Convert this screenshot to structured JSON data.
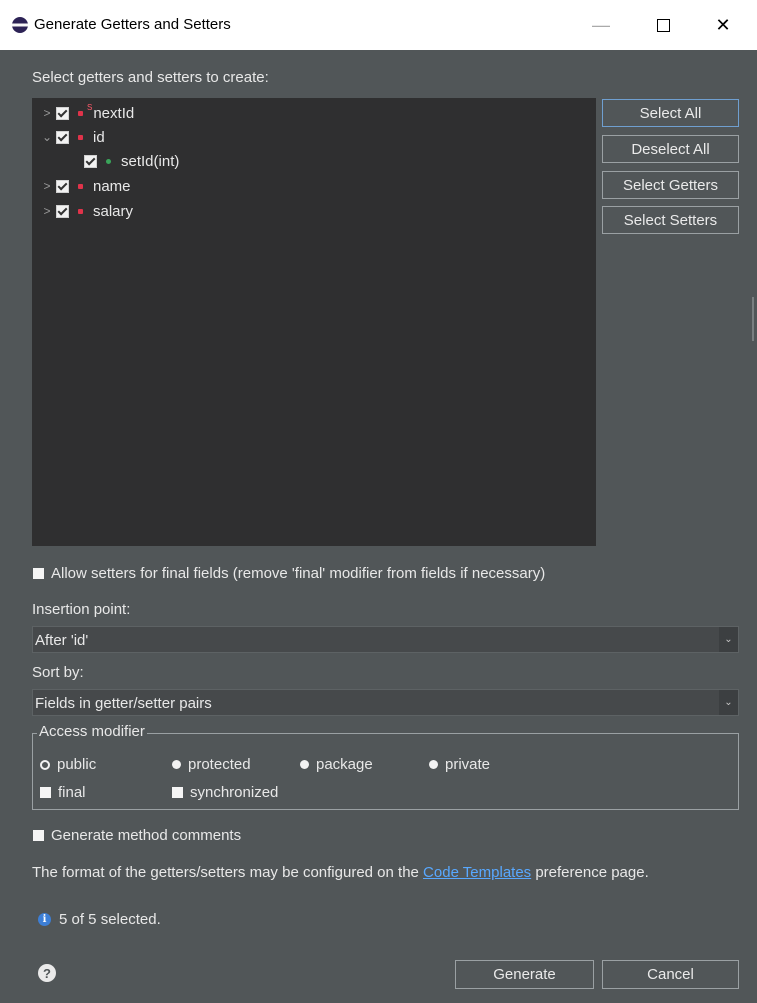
{
  "window": {
    "title": "Generate Getters and Setters",
    "minimize": "—",
    "close": "✕"
  },
  "dialog": {
    "tree_label": "Select getters and setters to create:",
    "tree": [
      {
        "label": "nextId",
        "expanded": false,
        "checked": true,
        "static_badge": "S",
        "level": 0
      },
      {
        "label": "id",
        "expanded": true,
        "checked": true,
        "level": 0
      },
      {
        "label": "setId(int)",
        "checked": true,
        "level": 1
      },
      {
        "label": "name",
        "expanded": false,
        "checked": true,
        "level": 0
      },
      {
        "label": "salary",
        "expanded": false,
        "checked": true,
        "level": 0
      }
    ],
    "buttons": {
      "select_all": "Select All",
      "deselect_all": "Deselect All",
      "select_getters": "Select Getters",
      "select_setters": "Select Setters"
    },
    "allow_final_label": "Allow setters for final fields (remove 'final' modifier from fields if necessary)",
    "insertion_point": {
      "label": "Insertion point:",
      "value": "After 'id'"
    },
    "sort_by": {
      "label": "Sort by:",
      "value": "Fields in getter/setter pairs"
    },
    "access_modifier": {
      "legend": "Access modifier",
      "options": [
        "public",
        "protected",
        "package",
        "private"
      ],
      "selected": "public",
      "final_label": "final",
      "synchronized_label": "synchronized"
    },
    "generate_comments_label": "Generate method comments",
    "format_note": {
      "before": "The format of the getters/setters may be configured on the ",
      "link": "Code Templates",
      "after": " preference page."
    },
    "status": "5 of 5 selected.",
    "footer": {
      "generate": "Generate",
      "cancel": "Cancel"
    }
  },
  "colors": {
    "background": "#515658",
    "tree_background": "#2f2f30",
    "link": "#58a8ff",
    "focus_border": "#6f9fd0"
  }
}
